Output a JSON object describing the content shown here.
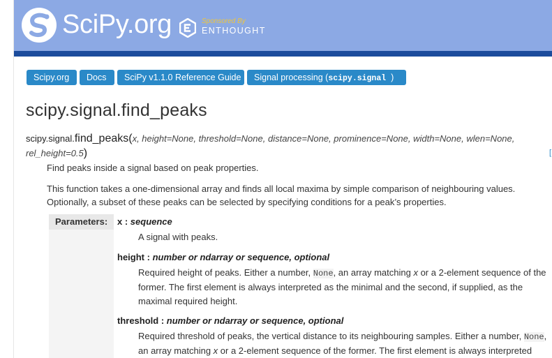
{
  "header": {
    "logo_text": "SciPy.org",
    "sponsor_label": "Sponsored By",
    "sponsor_name": "ENTHOUGHT",
    "colors": {
      "banner": "#8ca9e4",
      "bar": "#1c4c9c",
      "crumb": "#2a89c8",
      "sponsor": "#f0c63a"
    }
  },
  "breadcrumbs": {
    "item0": "Scipy.org",
    "item1": "Docs",
    "item2": "SciPy v1.1.0 Reference Guide",
    "item3_prefix": "Signal processing (",
    "item3_code": "scipy.signal",
    "item3_suffix": ")"
  },
  "page": {
    "title": "scipy.signal.find_peaks"
  },
  "signature": {
    "module": "scipy.signal.",
    "func": "find_peaks",
    "open_paren": "(",
    "args_line1": "x, height=None, threshold=None, distance=None, prominence=None, width=None, wlen=None,",
    "args_line2": "rel_height=0.5",
    "close_paren": ")",
    "source_link": "["
  },
  "description": {
    "summary": "Find peaks inside a signal based on peak properties.",
    "details": "This function takes a one-dimensional array and finds all local maxima by simple comparison of neighbouring values. Optionally, a subset of these peaks can be selected by specifying conditions for a peak’s properties."
  },
  "parameters": {
    "label": "Parameters:",
    "x": {
      "name": "x",
      "sep": " : ",
      "type": "sequence",
      "desc": "A signal with peaks."
    },
    "height": {
      "name": "height",
      "sep": " : ",
      "type": "number or ndarray or sequence, optional",
      "desc_a": "Required height of peaks. Either a number, ",
      "desc_code": "None",
      "desc_b": ", an array matching ",
      "desc_em": "x",
      "desc_c": " or a 2-element sequence of the former. The first element is always interpreted as the minimal and the second, if supplied, as the maximal required height."
    },
    "threshold": {
      "name": "threshold",
      "sep": " : ",
      "type": "number or ndarray or sequence, optional",
      "desc_a": "Required threshold of peaks, the vertical distance to its neighbouring samples. Either a number, ",
      "desc_code": "None",
      "desc_b": ", an array matching ",
      "desc_em": "x",
      "desc_c": " or a 2-element sequence of the former. The first element is always interpreted"
    }
  }
}
